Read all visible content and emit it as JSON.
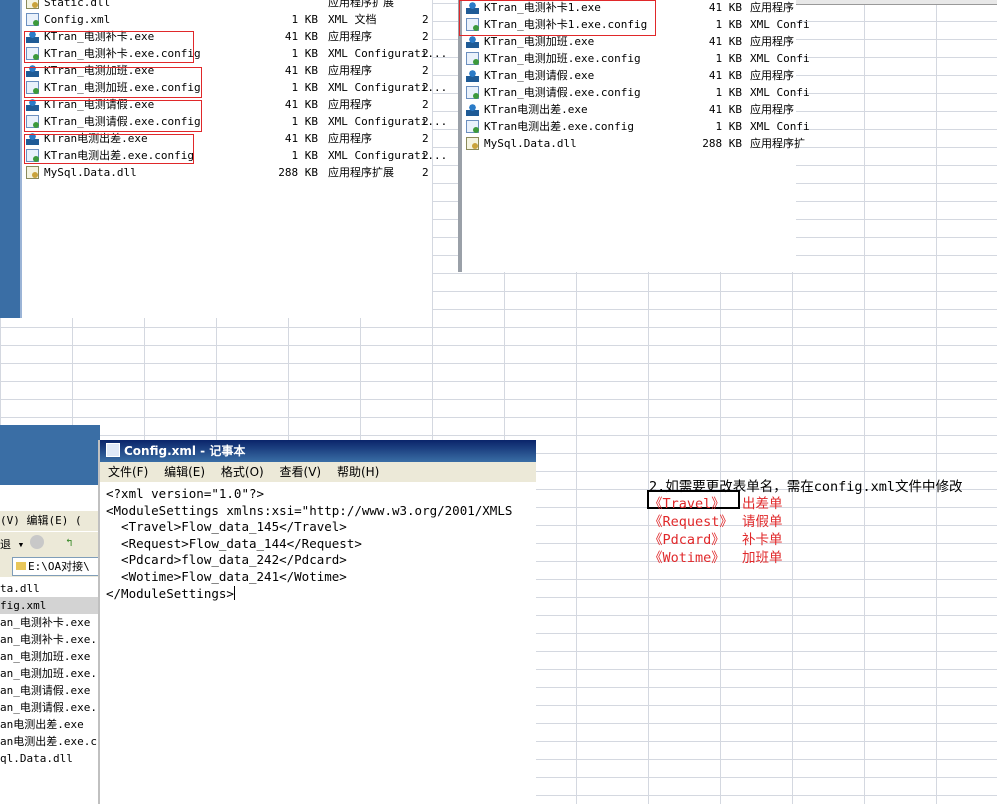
{
  "explorer_left": {
    "rows": [
      {
        "name": "Static.dll",
        "size": "",
        "type": "应用程序扩展",
        "date": "",
        "icon": "dll"
      },
      {
        "name": "Config.xml",
        "size": "1 KB",
        "type": "XML 文档",
        "date": "2",
        "icon": "cfg"
      },
      {
        "name": "KTran_电测补卡.exe",
        "size": "41 KB",
        "type": "应用程序",
        "date": "2",
        "icon": "exe"
      },
      {
        "name": "KTran_电测补卡.exe.config",
        "size": "1 KB",
        "type": "XML Configurati...",
        "date": "2",
        "icon": "cfg"
      },
      {
        "name": "KTran_电测加班.exe",
        "size": "41 KB",
        "type": "应用程序",
        "date": "2",
        "icon": "exe"
      },
      {
        "name": "KTran_电测加班.exe.config",
        "size": "1 KB",
        "type": "XML Configurati...",
        "date": "2",
        "icon": "cfg"
      },
      {
        "name": "KTran_电测请假.exe",
        "size": "41 KB",
        "type": "应用程序",
        "date": "2",
        "icon": "exe"
      },
      {
        "name": "KTran_电测请假.exe.config",
        "size": "1 KB",
        "type": "XML Configurati...",
        "date": "2",
        "icon": "cfg"
      },
      {
        "name": "KTran电测出差.exe",
        "size": "41 KB",
        "type": "应用程序",
        "date": "2",
        "icon": "exe"
      },
      {
        "name": "KTran电测出差.exe.config",
        "size": "1 KB",
        "type": "XML Configurati...",
        "date": "2",
        "icon": "cfg"
      },
      {
        "name": "MySql.Data.dll",
        "size": "288 KB",
        "type": "应用程序扩展",
        "date": "2",
        "icon": "dll"
      }
    ]
  },
  "explorer_right": {
    "rows": [
      {
        "name": "KTran_电测补卡1.exe",
        "size": "41 KB",
        "type": "应用程序",
        "icon": "exe"
      },
      {
        "name": "KTran_电测补卡1.exe.config",
        "size": "1 KB",
        "type": "XML Confi",
        "icon": "cfg"
      },
      {
        "name": "KTran_电测加班.exe",
        "size": "41 KB",
        "type": "应用程序",
        "icon": "exe"
      },
      {
        "name": "KTran_电测加班.exe.config",
        "size": "1 KB",
        "type": "XML Confi",
        "icon": "cfg"
      },
      {
        "name": "KTran_电测请假.exe",
        "size": "41 KB",
        "type": "应用程序",
        "icon": "exe"
      },
      {
        "name": "KTran_电测请假.exe.config",
        "size": "1 KB",
        "type": "XML Confi",
        "icon": "cfg"
      },
      {
        "name": "KTran电测出差.exe",
        "size": "41 KB",
        "type": "应用程序",
        "icon": "exe"
      },
      {
        "name": "KTran电测出差.exe.config",
        "size": "1 KB",
        "type": "XML Confi",
        "icon": "cfg"
      },
      {
        "name": "MySql.Data.dll",
        "size": "288 KB",
        "type": "应用程序扩",
        "icon": "dll"
      }
    ]
  },
  "bg_explorer": {
    "menu": "(V)  编辑(E)  (",
    "back_label": "退",
    "address": "E:\\OA对接\\",
    "files": [
      "ta.dll",
      "fig.xml",
      "an_电测补卡.exe",
      "an_电测补卡.exe.",
      "an_电测加班.exe",
      "an_电测加班.exe.",
      "an_电测请假.exe",
      "an_电测请假.exe.",
      "an电测出差.exe",
      "an电测出差.exe.c",
      "ql.Data.dll"
    ]
  },
  "notepad": {
    "title": "Config.xml - 记事本",
    "menu": [
      "文件(F)",
      "编辑(E)",
      "格式(O)",
      "查看(V)",
      "帮助(H)"
    ],
    "lines": [
      "<?xml version=\"1.0\"?>",
      "<ModuleSettings xmlns:xsi=\"http://www.w3.org/2001/XMLS",
      "  <Travel>Flow_data_145</Travel>",
      "  <Request>Flow_data_144</Request>",
      "  <Pdcard>flow_data_242</Pdcard>",
      "  <Wotime>Flow_data_241</Wotime>",
      "</ModuleSettings>"
    ]
  },
  "annotation": {
    "note": "2.如需要更改表单名，需在config.xml文件中修改",
    "tags": [
      {
        "key": "《Travel》",
        "value": "出差单"
      },
      {
        "key": "《Request》",
        "value": "请假单"
      },
      {
        "key": "《Pdcard》",
        "value": "补卡单"
      },
      {
        "key": "《Wotime》",
        "value": "加班单"
      }
    ]
  },
  "colors": {
    "highlight_red": "#e0282a",
    "title_blue": "#0a246a"
  }
}
